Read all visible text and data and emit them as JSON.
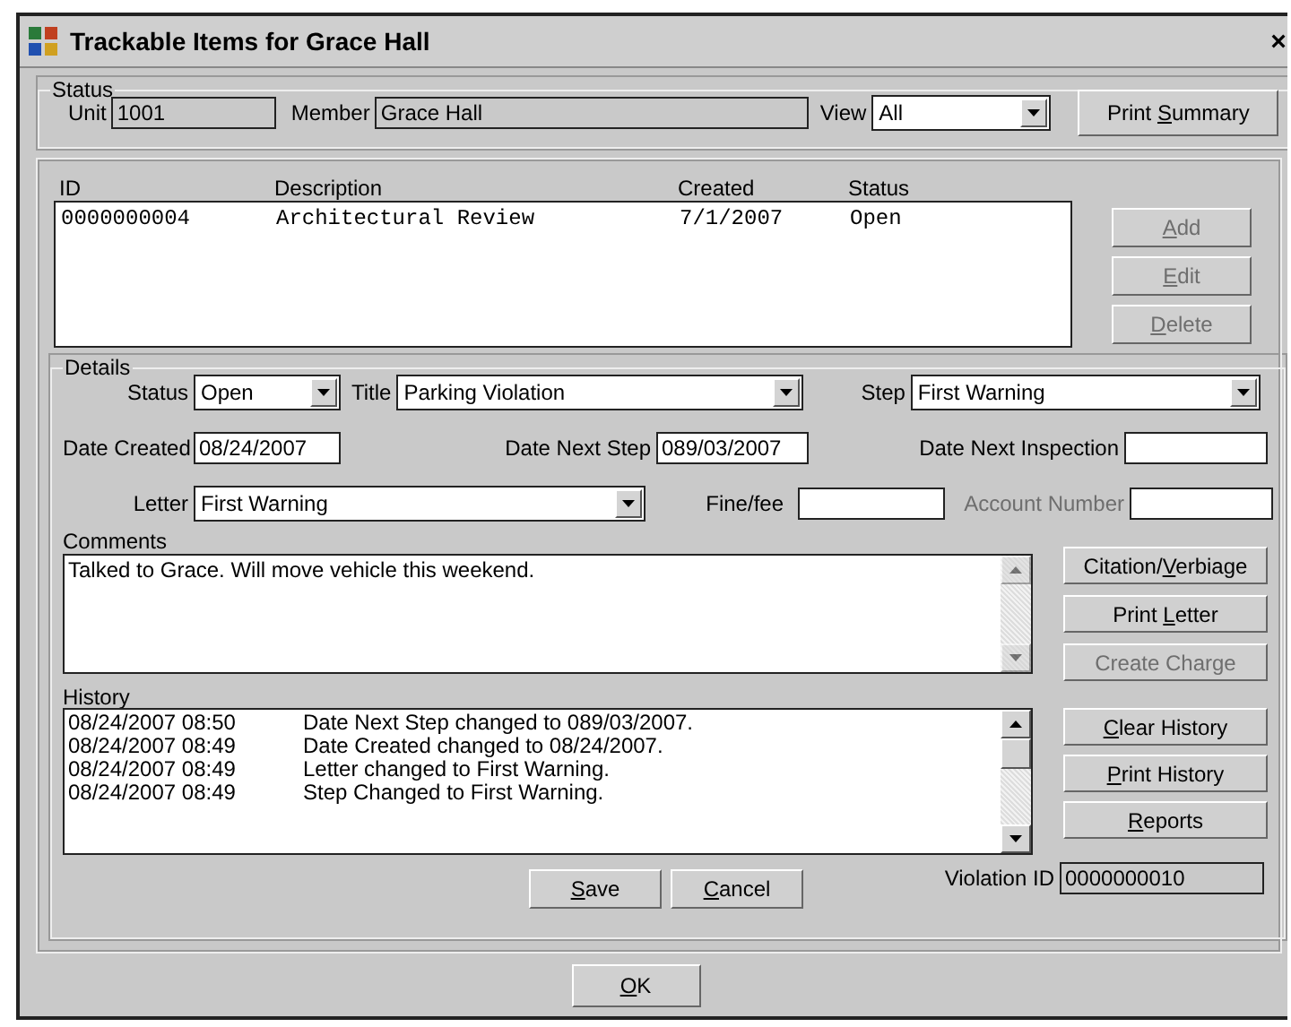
{
  "window": {
    "title": "Trackable Items for Grace Hall",
    "close": "×"
  },
  "status_group": {
    "legend": "Status",
    "unit_label": "Unit",
    "unit": "1001",
    "member_label": "Member",
    "member": "Grace Hall",
    "view_label": "View",
    "view": "All",
    "print_summary": {
      "pre": "Print ",
      "key": "S",
      "post": "ummary"
    }
  },
  "items": {
    "columns": [
      "ID",
      "Description",
      "Created",
      "Status"
    ],
    "rows": [
      {
        "cells": [
          "0000000004",
          "Architectural Review",
          "7/1/2007",
          "Open"
        ]
      }
    ],
    "buttons": [
      {
        "key": "A",
        "post": "dd",
        "disabled": true
      },
      {
        "key": "E",
        "post": "dit",
        "disabled": true
      },
      {
        "key": "D",
        "post": "elete",
        "disabled": true
      }
    ]
  },
  "details": {
    "legend": "Details",
    "status_label": "Status",
    "status": "Open",
    "title_label": "Title",
    "title": "Parking Violation",
    "step_label": "Step",
    "step": "First Warning",
    "date_created_label": "Date Created",
    "date_created": "08/24/2007",
    "date_next_step_label": "Date Next Step",
    "date_next_step": "089/03/2007",
    "date_next_inspection_label": "Date Next Inspection",
    "letter_label": "Letter",
    "letter": "First Warning",
    "fine_label": "Fine/fee",
    "account_label": "Account Number",
    "account_disabled": true,
    "comments_label": "Comments",
    "comments": "Talked to Grace. Will move vehicle this weekend.",
    "comment_buttons": [
      {
        "pre": "Citation/",
        "key": "V",
        "post": "erbiage",
        "disabled": false
      },
      {
        "pre": "Print ",
        "key": "L",
        "post": "etter",
        "disabled": false
      },
      {
        "pre": "Create Charge",
        "disabled": true
      }
    ],
    "history_label": "History",
    "history": [
      {
        "time": "08/24/2007 08:50",
        "text": "Date Next Step changed to 089/03/2007."
      },
      {
        "time": "08/24/2007 08:49",
        "text": "Date Created changed to 08/24/2007."
      },
      {
        "time": "08/24/2007 08:49",
        "text": "Letter changed to First Warning."
      },
      {
        "time": "08/24/2007 08:49",
        "text": "Step Changed to First Warning."
      }
    ],
    "history_buttons": [
      {
        "key": "C",
        "post": "lear History",
        "disabled": false
      },
      {
        "key": "P",
        "post": "rint History",
        "disabled": false
      },
      {
        "key": "R",
        "post": "eports",
        "disabled": false
      }
    ],
    "save": {
      "key": "S",
      "post": "ave"
    },
    "cancel": {
      "key": "C",
      "post": "ancel"
    },
    "violation_id_label": "Violation ID",
    "violation_id": "0000000010"
  },
  "ok": {
    "key": "O",
    "post": "K"
  }
}
